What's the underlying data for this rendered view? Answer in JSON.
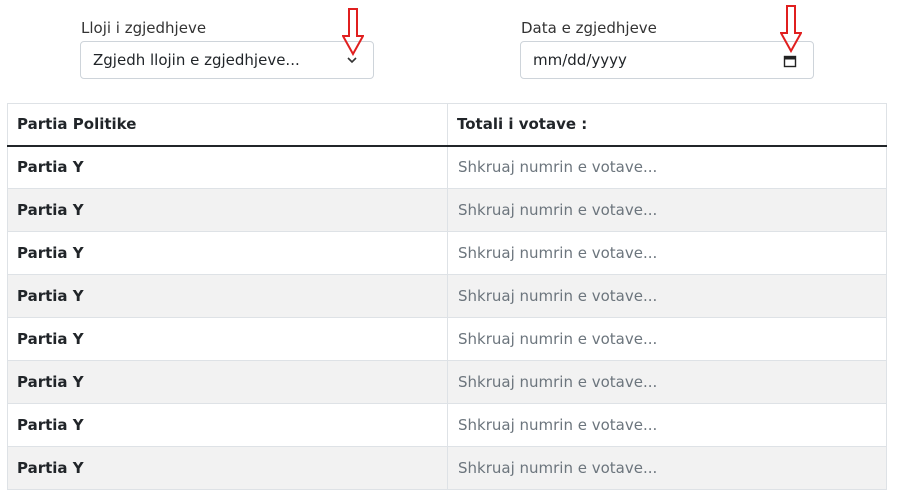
{
  "filters": {
    "election_type": {
      "label": "Lloji i zgjedhjeve",
      "selected": "Zgjedh llojin e zgjedhjeve..."
    },
    "election_date": {
      "label": "Data e zgjedhjeve",
      "placeholder": "mm/dd/yyyy"
    }
  },
  "annotations": {
    "arrow_color": "#e01f1f"
  },
  "table": {
    "headers": [
      "Partia Politike",
      "Totali i votave :"
    ],
    "rows": [
      {
        "party": "Partia Y",
        "votes_placeholder": "Shkruaj numrin e votave..."
      },
      {
        "party": "Partia Y",
        "votes_placeholder": "Shkruaj numrin e votave..."
      },
      {
        "party": "Partia Y",
        "votes_placeholder": "Shkruaj numrin e votave..."
      },
      {
        "party": "Partia Y",
        "votes_placeholder": "Shkruaj numrin e votave..."
      },
      {
        "party": "Partia Y",
        "votes_placeholder": "Shkruaj numrin e votave..."
      },
      {
        "party": "Partia Y",
        "votes_placeholder": "Shkruaj numrin e votave..."
      },
      {
        "party": "Partia Y",
        "votes_placeholder": "Shkruaj numrin e votave..."
      },
      {
        "party": "Partia Y",
        "votes_placeholder": "Shkruaj numrin e votave..."
      }
    ]
  }
}
